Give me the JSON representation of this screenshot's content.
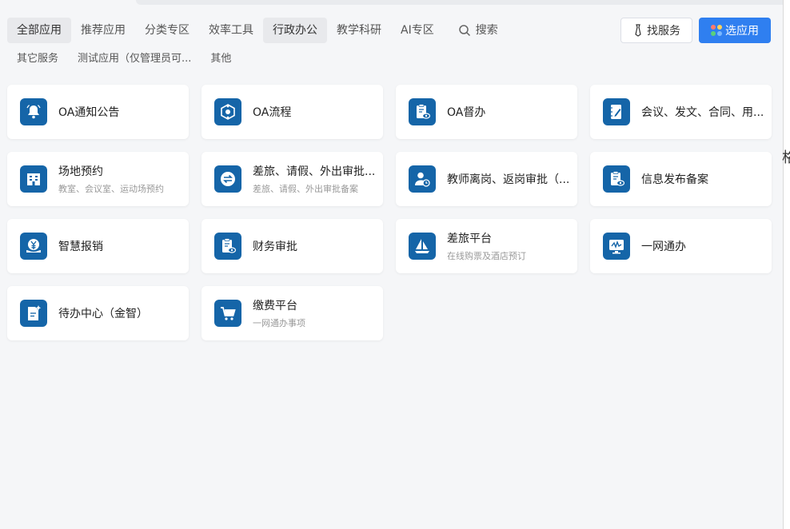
{
  "tabs": [
    {
      "label": "全部应用",
      "active": true
    },
    {
      "label": "推荐应用",
      "active": false
    },
    {
      "label": "分类专区",
      "active": false
    },
    {
      "label": "效率工具",
      "active": false
    },
    {
      "label": "行政办公",
      "active": true
    },
    {
      "label": "教学科研",
      "active": false
    },
    {
      "label": "AI专区",
      "active": false
    }
  ],
  "search": {
    "label": "搜索"
  },
  "subtabs": [
    "其它服务",
    "测试应用（仅管理员可...",
    "其他"
  ],
  "actions": {
    "service_label": "找服务",
    "apps_label": "选应用"
  },
  "colors": {
    "accent": "#2f7ff0",
    "icon_bg": "#1565a8"
  },
  "apps": [
    {
      "title": "OA通知公告",
      "sub": "",
      "icon": "bell-icon"
    },
    {
      "title": "OA流程",
      "sub": "",
      "icon": "workflow-icon"
    },
    {
      "title": "OA督办",
      "sub": "",
      "icon": "clipboard-eye-icon"
    },
    {
      "title": "会议、发文、合同、用...",
      "sub": "",
      "icon": "notebook-pen-icon"
    },
    {
      "title": "场地预约",
      "sub": "教室、会议室、运动场预约",
      "icon": "building-icon"
    },
    {
      "title": "差旅、请假、外出审批...",
      "sub": "差旅、请假、外出审批备案",
      "icon": "exchange-icon"
    },
    {
      "title": "教师离岗、返岗审批（...",
      "sub": "",
      "icon": "user-clock-icon"
    },
    {
      "title": "信息发布备案",
      "sub": "",
      "icon": "clipboard-eye-icon"
    },
    {
      "title": "智慧报销",
      "sub": "",
      "icon": "yen-hand-icon"
    },
    {
      "title": "财务审批",
      "sub": "",
      "icon": "clipboard-eye-icon"
    },
    {
      "title": "差旅平台",
      "sub": "在线购票及酒店预订",
      "icon": "sailboat-icon"
    },
    {
      "title": "一网通办",
      "sub": "",
      "icon": "monitor-pulse-icon"
    },
    {
      "title": "待办中心（金智）",
      "sub": "",
      "icon": "todo-doc-icon"
    },
    {
      "title": "缴费平台",
      "sub": "一网通办事项",
      "icon": "cart-icon"
    }
  ],
  "edge_glyph": "格"
}
